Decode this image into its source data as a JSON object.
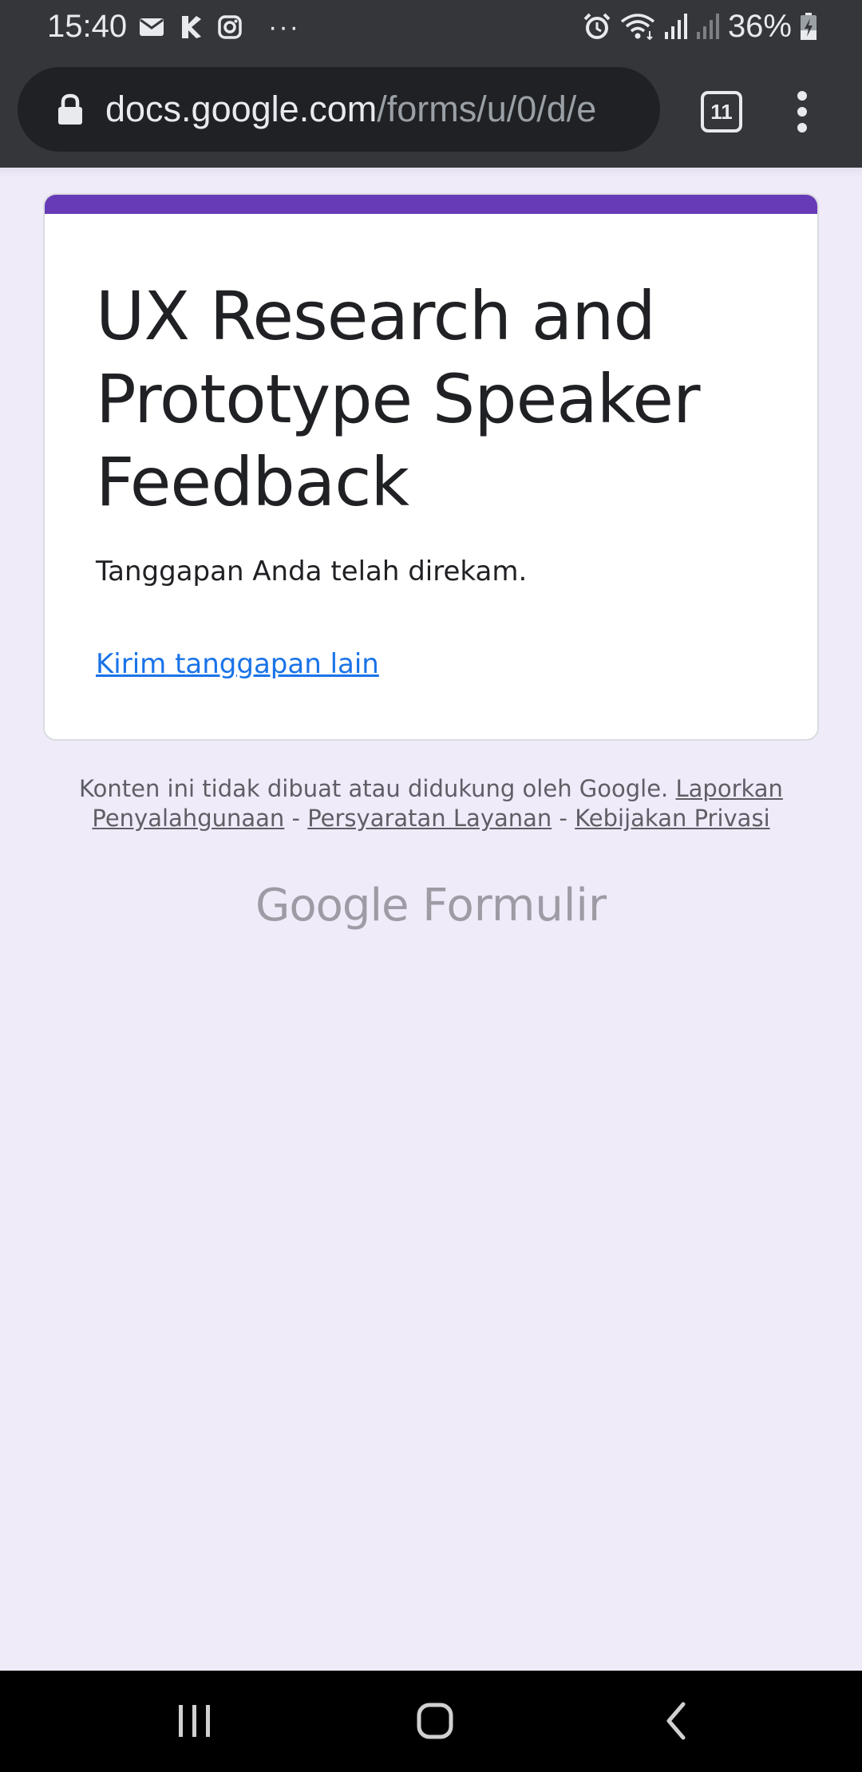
{
  "status_bar": {
    "time": "15:40",
    "left_icons": [
      "mail-icon",
      "app-icon",
      "instagram-icon",
      "more-dots-icon"
    ],
    "more_dots": "···",
    "right_icons": [
      "alarm-icon",
      "wifi-icon",
      "signal-icon",
      "signal-weak-icon",
      "battery-charging-icon"
    ],
    "battery": "36%"
  },
  "browser": {
    "url_host": "docs.google.com",
    "url_path": "/forms/u/0/d/e",
    "tab_count": "11",
    "icons": [
      "lock-icon",
      "tab-switcher-icon",
      "overflow-menu-icon"
    ]
  },
  "form": {
    "title": "UX Research and Prototype Speaker Feedback",
    "message": "Tanggapan Anda telah direkam.",
    "another_response_link": "Kirim tanggapan lain",
    "accent_color": "#673ab7"
  },
  "footer": {
    "disclaimer": "Konten ini tidak dibuat atau didukung oleh Google.",
    "report_link": "Laporkan Penyalahgunaan",
    "separator": "-",
    "terms_link": "Persyaratan Layanan",
    "privacy_link": "Kebijakan Privasi"
  },
  "brand": {
    "google": "Google",
    "product": "Formulir"
  },
  "nav_bar": {
    "buttons": [
      "recent-apps-icon",
      "home-icon",
      "back-icon"
    ]
  }
}
